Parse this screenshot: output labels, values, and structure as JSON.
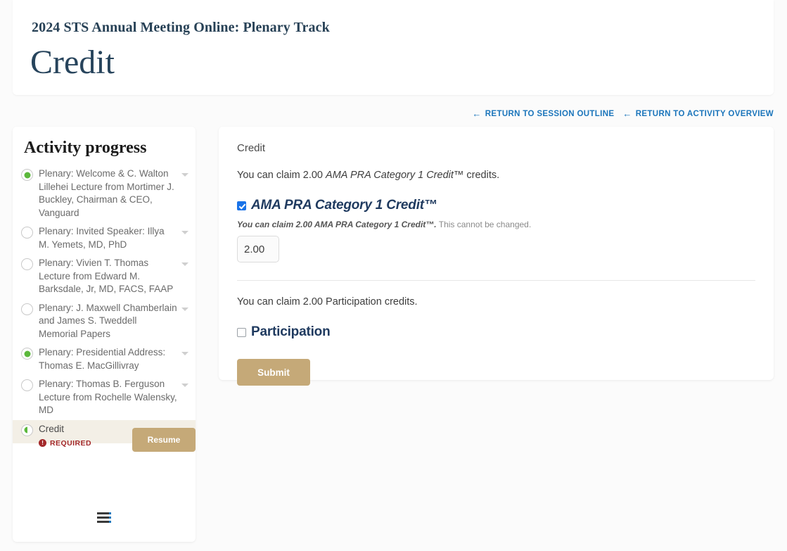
{
  "header": {
    "eyebrow": "2024 STS Annual Meeting Online: Plenary Track",
    "title": "Credit"
  },
  "nav": {
    "arrow_glyph": "←",
    "links": [
      {
        "label": "RETURN TO SESSION OUTLINE"
      },
      {
        "label": "RETURN TO ACTIVITY OVERVIEW"
      }
    ]
  },
  "sidebar": {
    "title": "Activity progress",
    "items": [
      {
        "label": "Plenary: Welcome & C. Walton Lillehei Lecture from Mortimer J. Buckley, Chairman & CEO, Vanguard",
        "state": "done"
      },
      {
        "label": "Plenary: Invited Speaker: Illya M. Yemets, MD, PhD",
        "state": "todo"
      },
      {
        "label": "Plenary: Vivien T. Thomas Lecture from Edward M. Barksdale, Jr, MD, FACS, FAAP",
        "state": "todo"
      },
      {
        "label": "Plenary: J. Maxwell Chamberlain and James S. Tweddell Memorial Papers",
        "state": "todo"
      },
      {
        "label": "Plenary: Presidential Address: Thomas E. MacGillivray",
        "state": "done"
      },
      {
        "label": "Plenary: Thomas B. Ferguson Lecture from Rochelle Walensky, MD",
        "state": "todo"
      },
      {
        "label": "Credit",
        "state": "partial",
        "current": true
      }
    ],
    "required_badge": "REQUIRED",
    "required_icon_glyph": "!",
    "resume_label": "Resume",
    "menu_icon": "hamburger-icon"
  },
  "main": {
    "section_label": "Credit",
    "ama_claim_prefix": "You can claim 2.00 ",
    "ama_claim_italic": "AMA PRA Category 1 Credit™",
    "ama_claim_suffix": " credits.",
    "ama_heading": "AMA PRA Category 1 Credit™",
    "ama_checked": true,
    "ama_helper_bold": "You can claim 2.00 AMA PRA Category 1 Credit™.",
    "ama_helper_rest": " This cannot be changed.",
    "credit_value": "2.00",
    "participation_claim": "You can claim 2.00 Participation credits.",
    "participation_heading": "Participation",
    "participation_checked": false,
    "submit_label": "Submit"
  },
  "colors": {
    "accent_blue": "#1b75bb",
    "brand_tan": "#c5a978",
    "required_red": "#a3282a",
    "progress_green": "#5cb83c",
    "heading_navy": "#1f3a5f",
    "highlight_beige": "#f3efe6"
  }
}
